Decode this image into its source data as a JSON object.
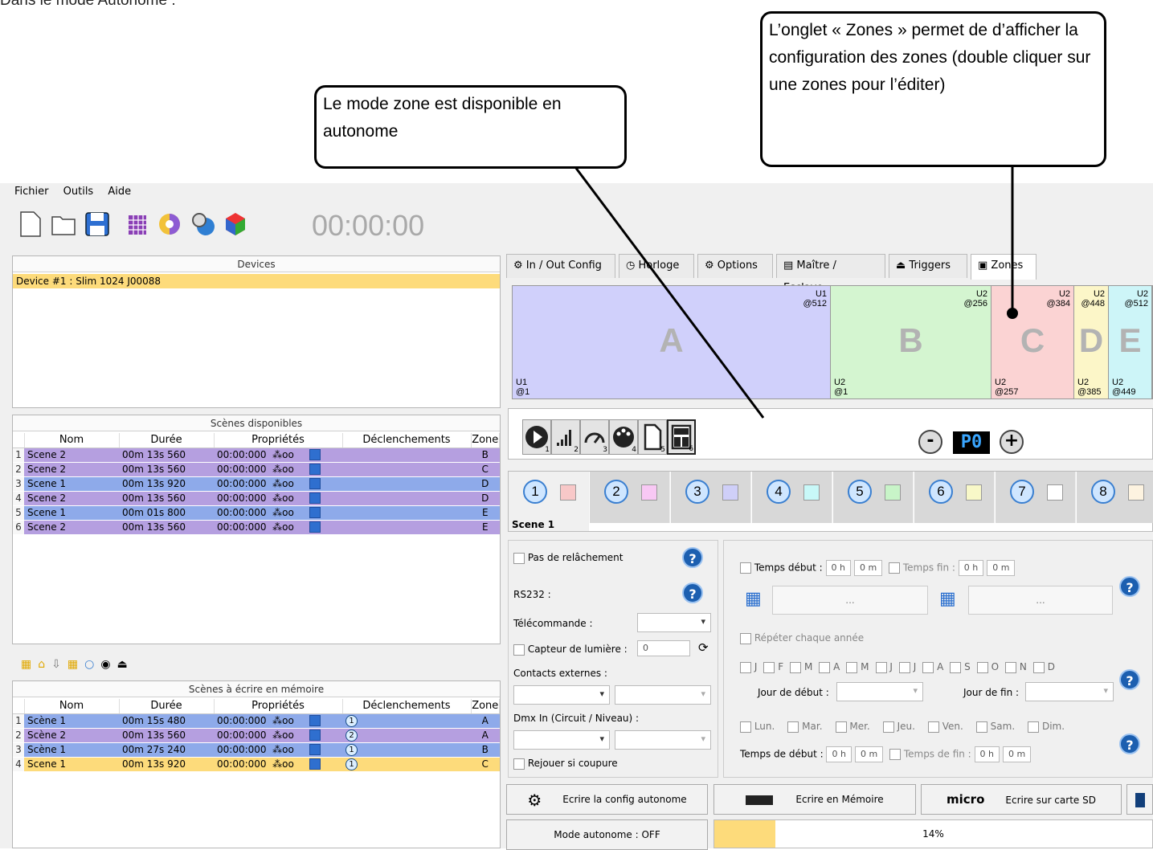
{
  "heading": "Dans le mode Autonome :",
  "callouts": {
    "left": "Le mode zone est disponible en autonome",
    "right": "L’onglet « Zones » permet de d’afficher la configuration des zones (double cliquer sur une zones pour l’éditer)"
  },
  "menu": {
    "fichier": "Fichier",
    "outils": "Outils",
    "aide": "Aide"
  },
  "toolbar": {
    "clock": "00:00:00"
  },
  "devices": {
    "title": "Devices",
    "items": [
      "Device #1 : Slim 1024 J00088"
    ]
  },
  "scenes_available": {
    "title": "Scènes disponibles",
    "headers": [
      "Nom",
      "Durée",
      "Propriétés",
      "Déclenchements",
      "Zone"
    ],
    "rows": [
      {
        "n": "1",
        "name": "Scene 2",
        "dur": "00m 13s 560",
        "prop": "00:00:000",
        "loop": "oo",
        "zone": "B",
        "color": "purple"
      },
      {
        "n": "2",
        "name": "Scene 2",
        "dur": "00m 13s 560",
        "prop": "00:00:000",
        "loop": "oo",
        "zone": "C",
        "color": "purple"
      },
      {
        "n": "3",
        "name": "Scene 1",
        "dur": "00m 13s 920",
        "prop": "00:00:000",
        "loop": "oo",
        "zone": "D",
        "color": "blue"
      },
      {
        "n": "4",
        "name": "Scene 2",
        "dur": "00m 13s 560",
        "prop": "00:00:000",
        "loop": "oo",
        "zone": "D",
        "color": "purple"
      },
      {
        "n": "5",
        "name": "Scene 1",
        "dur": "00m 01s 800",
        "prop": "00:00:000",
        "loop": "oo",
        "zone": "E",
        "color": "blue"
      },
      {
        "n": "6",
        "name": "Scene 2",
        "dur": "00m 13s 560",
        "prop": "00:00:000",
        "loop": "oo",
        "zone": "E",
        "color": "purple"
      }
    ]
  },
  "scenes_memory": {
    "title": "Scènes à écrire en mémoire",
    "headers": [
      "Nom",
      "Durée",
      "Propriétés",
      "Déclenchements",
      "Zone"
    ],
    "rows": [
      {
        "n": "1",
        "name": "Scène 1",
        "dur": "00m 15s 480",
        "prop": "00:00:000",
        "loop": "oo",
        "trig": "1",
        "zone": "A",
        "color": "blue"
      },
      {
        "n": "2",
        "name": "Scène 2",
        "dur": "00m 13s 560",
        "prop": "00:00:000",
        "loop": "oo",
        "trig": "2",
        "zone": "A",
        "color": "purple"
      },
      {
        "n": "3",
        "name": "Scène 1",
        "dur": "00m 27s 240",
        "prop": "00:00:000",
        "loop": "oo",
        "trig": "1",
        "zone": "B",
        "color": "blue"
      },
      {
        "n": "4",
        "name": "Scene 1",
        "dur": "00m 13s 920",
        "prop": "00:00:000",
        "loop": "oo",
        "trig": "1",
        "zone": "C",
        "color": "yellow"
      }
    ]
  },
  "tabs": [
    "In / Out Config",
    "Horloge",
    "Options",
    "Maître / Esclave",
    "Triggers",
    "Zones"
  ],
  "zones": [
    {
      "letter": "A",
      "top1": "U1",
      "top2": "@512",
      "bot1": "U1",
      "bot2": "@1",
      "color": "#d0d0fb"
    },
    {
      "letter": "B",
      "top1": "U2",
      "top2": "@256",
      "bot1": "U2",
      "bot2": "@1",
      "color": "#d4f5d0"
    },
    {
      "letter": "C",
      "top1": "U2",
      "top2": "@384",
      "bot1": "U2",
      "bot2": "@257",
      "color": "#fbd3d3"
    },
    {
      "letter": "D",
      "top1": "U2",
      "top2": "@448",
      "bot1": "U2",
      "bot2": "@385",
      "color": "#fcf6c8"
    },
    {
      "letter": "E",
      "top1": "U2",
      "top2": "@512",
      "bot1": "U2",
      "bot2": "@449",
      "color": "#cdf5f8"
    }
  ],
  "mode_buttons": [
    "1",
    "2",
    "3",
    "4",
    "5",
    "6"
  ],
  "page_display": "P0",
  "scene_tabs": [
    {
      "num": "1",
      "color": "#f8c8c8"
    },
    {
      "num": "2",
      "color": "#f8c8f4"
    },
    {
      "num": "3",
      "color": "#cfcff8"
    },
    {
      "num": "4",
      "color": "#c8f8f8"
    },
    {
      "num": "5",
      "color": "#c8f4c8"
    },
    {
      "num": "6",
      "color": "#f8f8c8"
    },
    {
      "num": "7",
      "color": "#ffffff"
    },
    {
      "num": "8",
      "color": "#fdf3e0"
    }
  ],
  "scene_label": "Scene 1",
  "left_opts": {
    "no_release": "Pas de relâchement",
    "rs232": "RS232 :",
    "remote": "Télécommande :",
    "light_sensor": "Capteur de lumière :",
    "light_value": "0",
    "ext_contacts": "Contacts externes :",
    "dmx_in": "Dmx In (Circuit / Niveau) :",
    "replay": "Rejouer si coupure"
  },
  "right_opts": {
    "start_time": "Temps début :",
    "end_time": "Temps fin :",
    "h": "0 h",
    "m": "0 m",
    "dots": "...",
    "repeat": "Répéter chaque année",
    "months": [
      "J",
      "F",
      "M",
      "A",
      "M",
      "J",
      "J",
      "A",
      "S",
      "O",
      "N",
      "D"
    ],
    "start_day": "Jour de début :",
    "end_day": "Jour de fin :",
    "days": [
      "Lun.",
      "Mar.",
      "Mer.",
      "Jeu.",
      "Ven.",
      "Sam.",
      "Dim."
    ],
    "start_time2": "Temps de début :",
    "end_time2": "Temps de fin :"
  },
  "actions": {
    "write_config": "Ecrire la config autonome",
    "write_memory": "Ecrire en Mémoire",
    "write_sd": "Ecrire sur carte SD",
    "micro": "micro",
    "mode": "Mode autonome : OFF",
    "progress_label": "14%",
    "progress": 0.14
  },
  "colors": {
    "purple": "#b59fe0",
    "blue": "#8eaaea",
    "yellow": "#fddb7b",
    "accent": "#1c5fb0"
  }
}
